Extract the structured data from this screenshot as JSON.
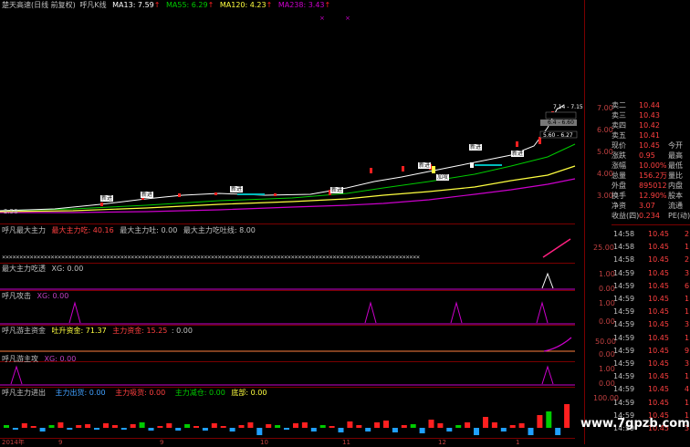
{
  "main_title": {
    "name": "楚天高速(日线 前复权)",
    "indicator": "呼凡K线",
    "ma13": "MA13: 7.59",
    "ma55": "MA55: 6.29",
    "ma120": "MA120: 4.23",
    "ma238": "MA238: 3.43",
    "arrow": "↑"
  },
  "colors": {
    "ma13": "#ffffff",
    "ma55": "#00cc00",
    "ma120": "#ffff40",
    "ma238": "#cc00cc",
    "up": "#ff2020",
    "down": "#00bbbb",
    "label_red": "#ff4040",
    "divider": "#7a0000"
  },
  "price_axis": [
    "7.00",
    "6.00",
    "5.00",
    "4.00",
    "3.00"
  ],
  "price_label_left": "2.58",
  "callouts": {
    "c1": "7.14 - 7.15",
    "c2": "6.4 - 6.60",
    "c3": "5.60 - 6.27"
  },
  "signals": {
    "jt": "新进",
    "gj": "加攻"
  },
  "panels": {
    "p1": {
      "title": "呼凡最大主力",
      "a": "最大主力吃: 40.16",
      "b": "最大主力吐: 0.00",
      "c": "最大主力吃吐线: 8.00",
      "axis": "25.00"
    },
    "p2": {
      "title": "最大主力吃透",
      "value": "XG: 0.00",
      "axis": [
        "1.00",
        "0.00"
      ]
    },
    "p3": {
      "title": "呼凡攻击",
      "value": "XG: 0.00",
      "axis": [
        "1.00",
        "0.00"
      ]
    },
    "p4": {
      "title": "呼凡游主资金",
      "a": "吐升资金: 71.37",
      "b": "主力资金: 15.25",
      "c": ": 0.00",
      "axis": [
        "50.00",
        "0.00"
      ]
    },
    "p5": {
      "title": "呼凡游主攻",
      "value": "XG: 0.00",
      "axis": [
        "1.00",
        "0.00"
      ]
    },
    "p6": {
      "title": "呼凡主力进出",
      "a": "主力出货: 0.00",
      "b": "主力吸货: 0.00",
      "c": "主力减仓: 0.00",
      "d": "底部: 0.00",
      "axis": "100.00"
    }
  },
  "date_axis": [
    "2014年",
    "9",
    "9",
    "10",
    "11",
    "12",
    "1"
  ],
  "order_book": [
    {
      "label": "卖二",
      "value": "10.44",
      "extra": ""
    },
    {
      "label": "卖三",
      "value": "10.43",
      "extra": ""
    },
    {
      "label": "卖四",
      "value": "10.42",
      "extra": ""
    },
    {
      "label": "卖五",
      "value": "10.41",
      "extra": ""
    },
    {
      "label": "现价",
      "value": "10.45",
      "extra": "今开"
    },
    {
      "label": "涨跌",
      "value": "0.95",
      "extra": "最高"
    },
    {
      "label": "涨幅",
      "value": "10.00%",
      "extra": "最低"
    },
    {
      "label": "总量",
      "value": "156.2万",
      "extra": "量比"
    },
    {
      "label": "外盘",
      "value": "895012",
      "extra": "内盘"
    },
    {
      "label": "换手",
      "value": "12.90%",
      "extra": "股本"
    },
    {
      "label": "净资",
      "value": "3.07",
      "extra": "流通"
    },
    {
      "label": "收益(四)",
      "value": "0.234",
      "extra": "PE(动)"
    }
  ],
  "ticks": [
    {
      "time": "14:58",
      "price": "10.45",
      "vol": "2"
    },
    {
      "time": "14:58",
      "price": "10.45",
      "vol": "1"
    },
    {
      "time": "14:58",
      "price": "10.45",
      "vol": "2"
    },
    {
      "time": "14:59",
      "price": "10.45",
      "vol": "3"
    },
    {
      "time": "14:59",
      "price": "10.45",
      "vol": "6"
    },
    {
      "time": "14:59",
      "price": "10.45",
      "vol": "1"
    },
    {
      "time": "14:59",
      "price": "10.45",
      "vol": "1"
    },
    {
      "time": "14:59",
      "price": "10.45",
      "vol": "3"
    },
    {
      "time": "14:59",
      "price": "10.45",
      "vol": "1"
    },
    {
      "time": "14:59",
      "price": "10.45",
      "vol": "9"
    },
    {
      "time": "14:59",
      "price": "10.45",
      "vol": "3"
    },
    {
      "time": "14:59",
      "price": "10.45",
      "vol": "1"
    },
    {
      "time": "14:59",
      "price": "10.45",
      "vol": "4"
    },
    {
      "time": "14:59",
      "price": "10.45",
      "vol": "1"
    },
    {
      "time": "14:59",
      "price": "10.45",
      "vol": "1"
    },
    {
      "time": "14:59",
      "price": "10.45",
      "vol": "3"
    }
  ],
  "watermark": "www.7gpzb.com"
}
